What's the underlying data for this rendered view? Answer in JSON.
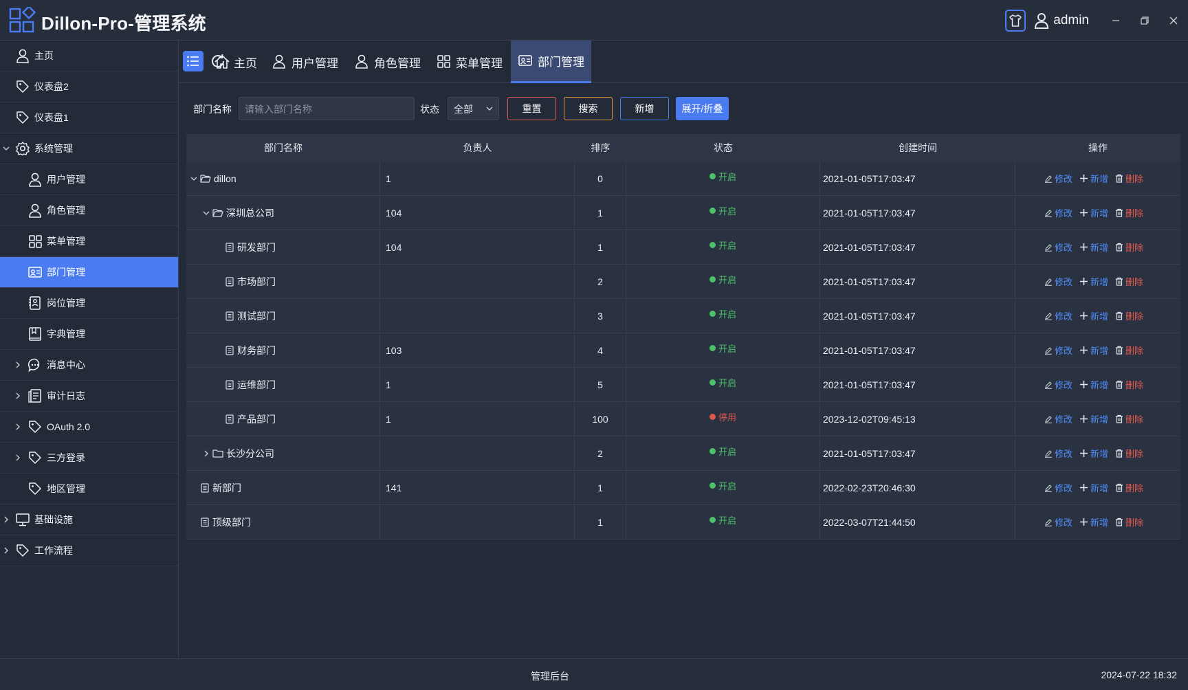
{
  "app": {
    "title": "Dillon-Pro-管理系统",
    "user": "admin",
    "accent": "#4b7bf1"
  },
  "sidebar": {
    "items": [
      {
        "label": "主页",
        "icon": "user-icon",
        "level": 0,
        "arrow": "",
        "active": false
      },
      {
        "label": "仪表盘2",
        "icon": "tag-icon",
        "level": 0,
        "arrow": "",
        "active": false
      },
      {
        "label": "仪表盘1",
        "icon": "tag-icon",
        "level": 0,
        "arrow": "",
        "active": false
      },
      {
        "label": "系统管理",
        "icon": "gear-icon",
        "level": 0,
        "arrow": "down",
        "active": false
      },
      {
        "label": "用户管理",
        "icon": "user-icon",
        "level": 1,
        "arrow": "",
        "active": false
      },
      {
        "label": "角色管理",
        "icon": "user-icon",
        "level": 1,
        "arrow": "",
        "active": false
      },
      {
        "label": "菜单管理",
        "icon": "grid-icon",
        "level": 1,
        "arrow": "",
        "active": false
      },
      {
        "label": "部门管理",
        "icon": "id-card-icon",
        "level": 1,
        "arrow": "",
        "active": true
      },
      {
        "label": "岗位管理",
        "icon": "badge-icon",
        "level": 1,
        "arrow": "",
        "active": false
      },
      {
        "label": "字典管理",
        "icon": "book-icon",
        "level": 1,
        "arrow": "",
        "active": false
      },
      {
        "label": "消息中心",
        "icon": "chat-icon",
        "level": 1,
        "arrow": "right",
        "active": false
      },
      {
        "label": "审计日志",
        "icon": "log-icon",
        "level": 1,
        "arrow": "right",
        "active": false
      },
      {
        "label": "OAuth 2.0",
        "icon": "tag-icon",
        "level": 1,
        "arrow": "right",
        "active": false
      },
      {
        "label": "三方登录",
        "icon": "tag-icon",
        "level": 1,
        "arrow": "right",
        "active": false
      },
      {
        "label": "地区管理",
        "icon": "tag-icon",
        "level": 1,
        "arrow": "",
        "active": false
      },
      {
        "label": "基础设施",
        "icon": "monitor-icon",
        "level": 0,
        "arrow": "right",
        "active": false
      },
      {
        "label": "工作流程",
        "icon": "tag-icon",
        "level": 0,
        "arrow": "right",
        "active": false
      }
    ]
  },
  "tabs": [
    {
      "label": "主页",
      "icon": "home-icon",
      "active": false
    },
    {
      "label": "用户管理",
      "icon": "user-icon",
      "active": false
    },
    {
      "label": "角色管理",
      "icon": "user-icon",
      "active": false
    },
    {
      "label": "菜单管理",
      "icon": "grid-icon",
      "active": false
    },
    {
      "label": "部门管理",
      "icon": "id-card-icon",
      "active": true
    }
  ],
  "search": {
    "name_label": "部门名称",
    "name_placeholder": "请输入部门名称",
    "status_label": "状态",
    "status_value": "全部",
    "reset_label": "重置",
    "search_label": "搜索",
    "add_label": "新增",
    "toggle_label": "展开/折叠"
  },
  "table": {
    "headers": [
      "部门名称",
      "负责人",
      "排序",
      "状态",
      "创建时间",
      "操作"
    ],
    "op_labels": {
      "edit": "修改",
      "add": "新增",
      "delete": "删除"
    },
    "rows": [
      {
        "name": "dillon",
        "indent": 0,
        "node": "folder-open",
        "caret": "down",
        "leader": "1",
        "sort": "0",
        "status": "开启",
        "status_color": "#4cc26b",
        "time": "2021-01-05T17:03:47"
      },
      {
        "name": "深圳总公司",
        "indent": 1,
        "node": "folder-open",
        "caret": "down",
        "leader": "104",
        "sort": "1",
        "status": "开启",
        "status_color": "#4cc26b",
        "time": "2021-01-05T17:03:47"
      },
      {
        "name": "研发部门",
        "indent": 2,
        "node": "doc",
        "caret": "",
        "leader": "104",
        "sort": "1",
        "status": "开启",
        "status_color": "#4cc26b",
        "time": "2021-01-05T17:03:47"
      },
      {
        "name": "市场部门",
        "indent": 2,
        "node": "doc",
        "caret": "",
        "leader": "",
        "sort": "2",
        "status": "开启",
        "status_color": "#4cc26b",
        "time": "2021-01-05T17:03:47"
      },
      {
        "name": "测试部门",
        "indent": 2,
        "node": "doc",
        "caret": "",
        "leader": "",
        "sort": "3",
        "status": "开启",
        "status_color": "#4cc26b",
        "time": "2021-01-05T17:03:47"
      },
      {
        "name": "财务部门",
        "indent": 2,
        "node": "doc",
        "caret": "",
        "leader": "103",
        "sort": "4",
        "status": "开启",
        "status_color": "#4cc26b",
        "time": "2021-01-05T17:03:47"
      },
      {
        "name": "运维部门",
        "indent": 2,
        "node": "doc",
        "caret": "",
        "leader": "1",
        "sort": "5",
        "status": "开启",
        "status_color": "#4cc26b",
        "time": "2021-01-05T17:03:47"
      },
      {
        "name": "产品部门",
        "indent": 2,
        "node": "doc",
        "caret": "",
        "leader": "1",
        "sort": "100",
        "status": "停用",
        "status_color": "#e1574b",
        "time": "2023-12-02T09:45:13"
      },
      {
        "name": "长沙分公司",
        "indent": 1,
        "node": "folder",
        "caret": "right",
        "leader": "",
        "sort": "2",
        "status": "开启",
        "status_color": "#4cc26b",
        "time": "2021-01-05T17:03:47"
      },
      {
        "name": "新部门",
        "indent": 0,
        "node": "doc",
        "caret": "",
        "leader": "141",
        "sort": "1",
        "status": "开启",
        "status_color": "#4cc26b",
        "time": "2022-02-23T20:46:30"
      },
      {
        "name": "顶级部门",
        "indent": 0,
        "node": "doc",
        "caret": "",
        "leader": "",
        "sort": "1",
        "status": "开启",
        "status_color": "#4cc26b",
        "time": "2022-03-07T21:44:50"
      }
    ]
  },
  "footer": {
    "center": "管理后台",
    "datetime": "2024-07-22 18:32"
  }
}
